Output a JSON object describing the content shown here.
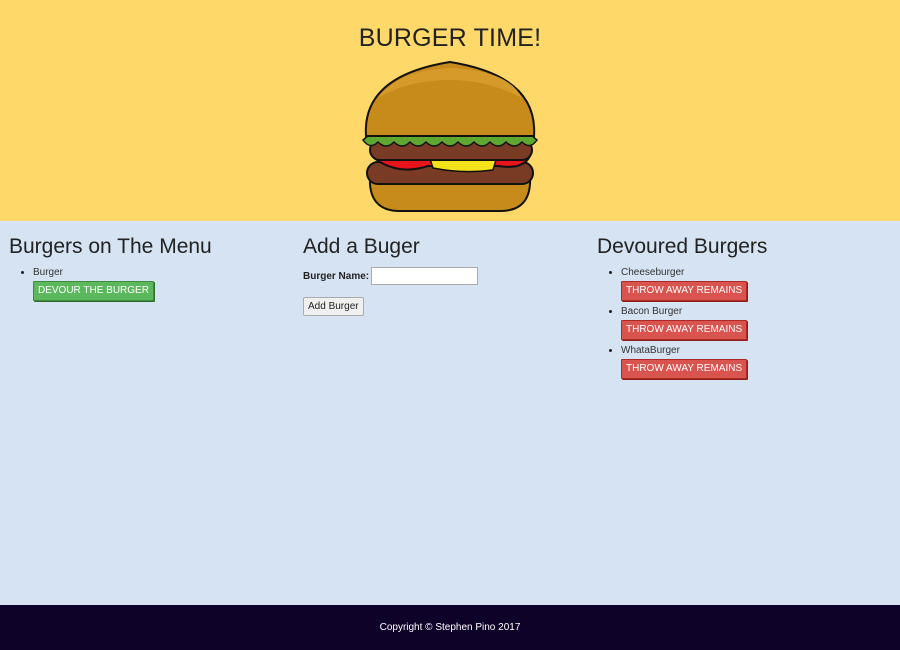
{
  "header": {
    "title": "BURGER TIME!",
    "logo_icon": "hamburger-icon"
  },
  "menu": {
    "heading": "Burgers on The Menu",
    "items": [
      {
        "name": "Burger",
        "button": "DEVOUR THE BURGER"
      }
    ]
  },
  "add": {
    "heading": "Add a Buger",
    "label": "Burger Name:",
    "input_value": "",
    "input_placeholder": "",
    "button": "Add Burger"
  },
  "devoured": {
    "heading": "Devoured Burgers",
    "items": [
      {
        "name": "Cheeseburger",
        "button": "THROW AWAY REMAINS"
      },
      {
        "name": "Bacon Burger",
        "button": "THROW AWAY REMAINS"
      },
      {
        "name": "WhataBurger",
        "button": "THROW AWAY REMAINS"
      }
    ]
  },
  "footer": {
    "text": "Copyright © Stephen Pino 2017"
  },
  "colors": {
    "header_bg": "#ffd86a",
    "main_bg": "#d6e3f2",
    "footer_bg": "#0f0228",
    "devour_button": "#5cb85c",
    "throw_button": "#d9534f"
  }
}
